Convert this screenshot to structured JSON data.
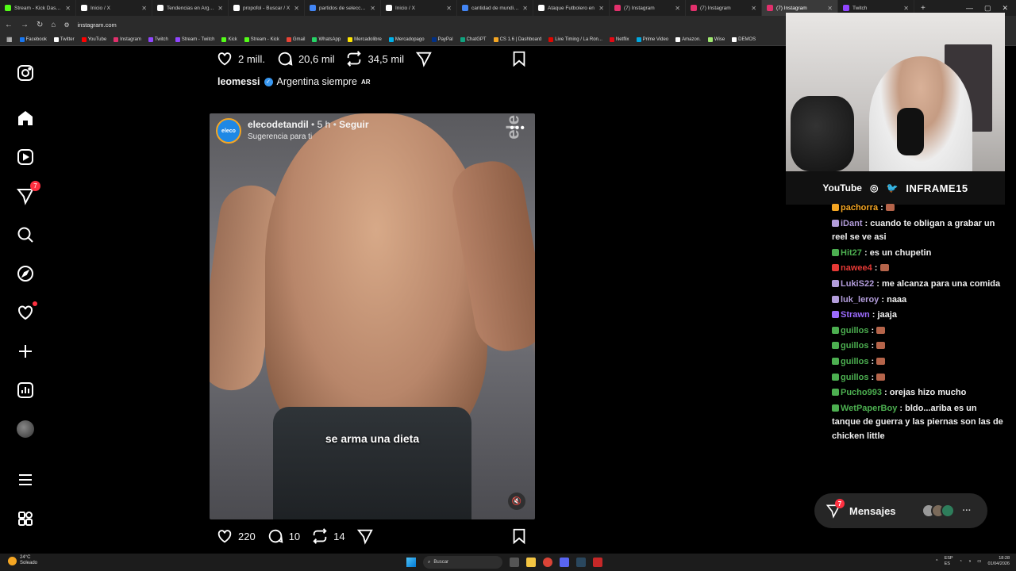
{
  "tabs": [
    {
      "label": "Stream - Kick Dashbo",
      "color": "#53fc18"
    },
    {
      "label": "Inicio / X",
      "color": "#ffffff"
    },
    {
      "label": "Tendencias en Argent",
      "color": "#ffffff"
    },
    {
      "label": "propofol - Buscar / X",
      "color": "#ffffff"
    },
    {
      "label": "partidos de selección",
      "color": "#4285f4"
    },
    {
      "label": "Inicio / X",
      "color": "#ffffff"
    },
    {
      "label": "cantidad de mundiale",
      "color": "#4285f4"
    },
    {
      "label": "Ataque Futbolero en",
      "color": "#ffffff"
    },
    {
      "label": "(7) Instagram",
      "color": "#e1306c"
    },
    {
      "label": "(7) Instagram",
      "color": "#e1306c"
    },
    {
      "label": "(7) Instagram",
      "color": "#e1306c"
    },
    {
      "label": "Twitch",
      "color": "#9146ff"
    }
  ],
  "address": {
    "url": "instagram.com"
  },
  "bookmarks": [
    "Facebook",
    "Twitter",
    "YouTube",
    "Instagram",
    "Twitch",
    "Stream - Twitch",
    "Kick",
    "Stream - Kick",
    "Gmail",
    "WhatsApp",
    "Mercadolibre",
    "Mercadopago",
    "PayPal",
    "ChatGPT",
    "CS 1.6 | Dashboard",
    "Live Timing / La Ron...",
    "Netflix",
    "Prime Video",
    "Amazon.",
    "Wise",
    "DEMOS"
  ],
  "sidebar": {
    "notifications_badge": "7"
  },
  "top_actions": {
    "likes": "2 mill.",
    "comments": "20,6 mil",
    "reposts": "34,5 mil"
  },
  "caption": {
    "user": "leomessi",
    "text": "Argentina siempre",
    "flag": "AR"
  },
  "post": {
    "avatar_text": "eleco",
    "user": "elecodetandil",
    "time": "5 h",
    "follow": "Seguir",
    "suggestion": "Sugerencia para ti",
    "brand_watermark": "ele",
    "subtitle": "se arma una dieta"
  },
  "bottom_actions": {
    "likes": "220",
    "comments": "10",
    "reposts": "14"
  },
  "messages": {
    "label": "Mensajes",
    "badge": "7"
  },
  "stream": {
    "platform": "YouTube",
    "handle": "INFRAME15"
  },
  "chat": [
    {
      "user": "pachorra",
      "color": "#f5a623",
      "msg": ""
    },
    {
      "user": "iDant",
      "color": "#b39ddb",
      "msg": "cuando te obligan a grabar un reel se ve asi"
    },
    {
      "user": "Hit27",
      "color": "#4caf50",
      "msg": "es un chupetin"
    },
    {
      "user": "nawee4",
      "color": "#e53935",
      "msg": ""
    },
    {
      "user": "LukiS22",
      "color": "#b39ddb",
      "msg": "me alcanza para una comida"
    },
    {
      "user": "luk_leroy",
      "color": "#b39ddb",
      "msg": "naaa"
    },
    {
      "user": "Strawn",
      "color": "#9c6bff",
      "msg": "jaaja"
    },
    {
      "user": "guillos",
      "color": "#4caf50",
      "msg": ""
    },
    {
      "user": "guillos",
      "color": "#4caf50",
      "msg": ""
    },
    {
      "user": "guillos",
      "color": "#4caf50",
      "msg": ""
    },
    {
      "user": "guillos",
      "color": "#4caf50",
      "msg": ""
    },
    {
      "user": "Pucho993",
      "color": "#4caf50",
      "msg": "orejas hizo mucho"
    },
    {
      "user": "WetPaperBoy",
      "color": "#4caf50",
      "msg": "bldo...ariba es un tanque de guerra y las piernas son las de chicken little"
    }
  ],
  "taskbar": {
    "temp": "24°C",
    "weather": "Soleado",
    "search": "Buscar",
    "lang": "ESP",
    "region": "ES",
    "time": "18:28",
    "date": "01/04/2026"
  }
}
